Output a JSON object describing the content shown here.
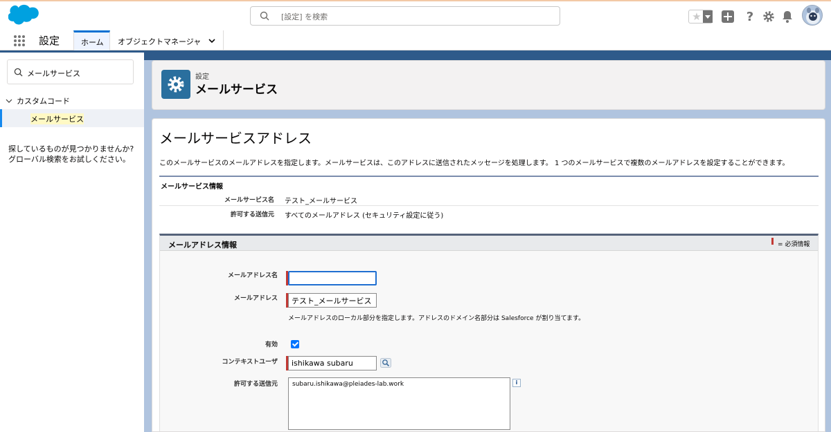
{
  "header": {
    "search_placeholder": "[設定] を検索",
    "icons": [
      "salesforce-cloud-logo",
      "search-icon",
      "favorite-star-icon",
      "add-icon",
      "help-icon",
      "gear-icon",
      "bell-icon",
      "avatar"
    ]
  },
  "appnav": {
    "app_name": "設定",
    "tabs": [
      {
        "label": "ホーム",
        "active": true
      },
      {
        "label": "オブジェクトマネージャ",
        "has_dropdown": true
      }
    ]
  },
  "sidebar": {
    "quickfind_value": "メールサービス",
    "tree_parent": "カスタムコード",
    "tree_child": "メールサービス",
    "not_found_line1": "探しているものが見つかりませんか?",
    "not_found_line2": "グローバル検索をお試しください。"
  },
  "page_header": {
    "breadcrumb": "設定",
    "title": "メールサービス"
  },
  "main": {
    "heading": "メールサービスアドレス",
    "description": "このメールサービスのメールアドレスを指定します。メールサービスは、このアドレスに送信されたメッセージを処理します。 1 つのメールサービスで複数のメールアドレスを設定することができます。",
    "service_info": {
      "title": "メールサービス情報",
      "rows": [
        {
          "label": "メールサービス名",
          "value": "テスト_メールサービス"
        },
        {
          "label": "許可する送信元",
          "value": "すべてのメールアドレス (セキュリティ設定に従う)"
        }
      ]
    },
    "address_info": {
      "title": "メールアドレス情報",
      "required_legend": "= 必須情報",
      "fields": {
        "address_name_label": "メールアドレス名",
        "address_name_value": "",
        "address_label": "メールアドレス",
        "address_value": "テスト_メールサービス",
        "address_hint": "メールアドレスのローカル部分を指定します。アドレスのドメイン名部分は Salesforce が割り当てます。",
        "active_label": "有効",
        "active_checked": true,
        "context_user_label": "コンテキストユーザ",
        "context_user_value": "ishikawa subaru",
        "allowed_senders_label": "許可する送信元",
        "allowed_senders_value": "subaru.ishikawa@pleiades-lab.work",
        "info_glyph": "i"
      }
    }
  },
  "colors": {
    "brand_blue": "#00a1e0",
    "band_blue": "#b0c4df",
    "required_red": "#c23934",
    "settings_icon_bg": "#2a6f9e"
  }
}
